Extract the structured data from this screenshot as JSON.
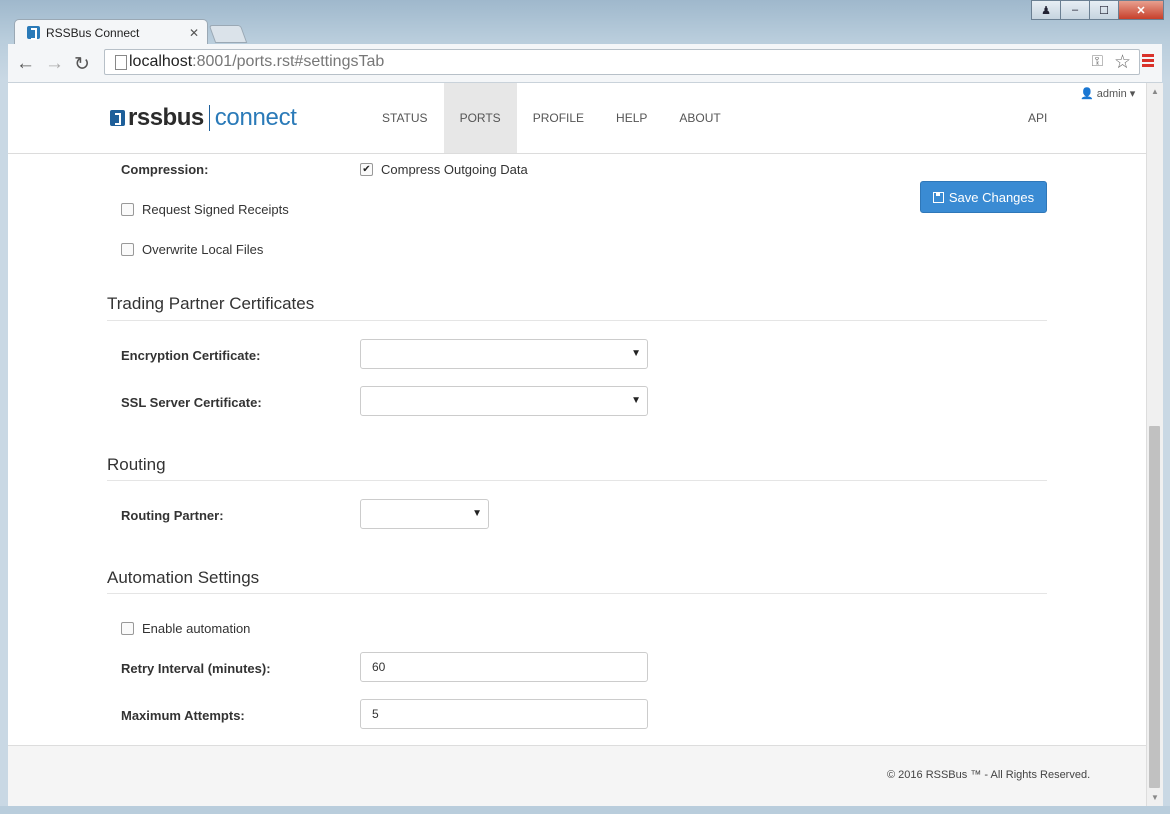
{
  "window": {
    "tab_title": "RSSBus Connect",
    "url_host": "localhost",
    "url_rest": ":8001/ports.rst#settingsTab"
  },
  "nav": {
    "logo_left": "rssbus",
    "logo_right": "connect",
    "items": [
      "STATUS",
      "PORTS",
      "PROFILE",
      "HELP",
      "ABOUT"
    ],
    "active": "PORTS",
    "api": "API",
    "user": "admin"
  },
  "form": {
    "compression_label": "Compression:",
    "compress_outgoing": {
      "label": "Compress Outgoing Data",
      "checked": true
    },
    "request_signed_receipts": {
      "label": "Request Signed Receipts",
      "checked": false
    },
    "overwrite_local_files": {
      "label": "Overwrite Local Files",
      "checked": false
    },
    "save_label": "Save Changes",
    "certs_heading": "Trading Partner Certificates",
    "encryption_cert_label": "Encryption Certificate:",
    "encryption_cert_value": "",
    "ssl_cert_label": "SSL Server Certificate:",
    "ssl_cert_value": "",
    "routing_heading": "Routing",
    "routing_partner_label": "Routing Partner:",
    "routing_partner_value": "",
    "automation_heading": "Automation Settings",
    "enable_automation": {
      "label": "Enable automation",
      "checked": false
    },
    "retry_interval_label": "Retry Interval (minutes):",
    "retry_interval_value": "60",
    "max_attempts_label": "Maximum Attempts:",
    "max_attempts_value": "5"
  },
  "footer": {
    "text": "© 2016 RSSBus ™ - All Rights Reserved."
  },
  "colors": {
    "accent": "#3a8bd3",
    "brand_blue": "#2a7ab8"
  }
}
